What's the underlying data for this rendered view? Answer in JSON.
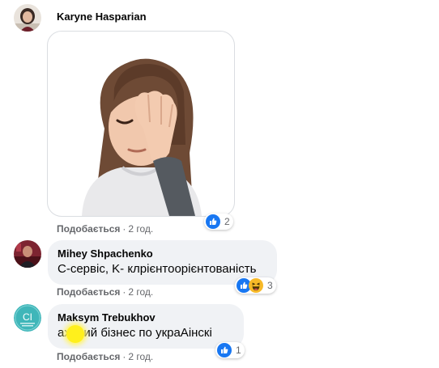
{
  "colors": {
    "bubble_bg": "#f0f2f5",
    "meta_text": "#65676b",
    "like_blue": "#1877f2",
    "haha_yellow": "#f7b928",
    "censor_yellow": "#fff01c"
  },
  "comments": [
    {
      "author": "Karyne Hasparian",
      "avatar_icon": "profile-photo",
      "attachment": "facepalm-avatar-sticker",
      "like_label": "Подобається",
      "time": "2 год.",
      "reaction_icons": [
        "like-icon"
      ],
      "reaction_count": "2"
    },
    {
      "author": "Mihey Shpachenko",
      "avatar_icon": "profile-photo",
      "text": "C-сервіс, K- клрієнтоорієнтованість",
      "like_label": "Подобається",
      "time": "2 год.",
      "reaction_icons": [
        "like-icon",
        "haha-icon"
      ],
      "reaction_count": "3"
    },
    {
      "author": "Maksym Trebukhov",
      "avatar_icon": "profile-logo-ci",
      "avatar_text": "CI",
      "text_prefix": "ах",
      "text_rest": "нний бізнес по украАінскі",
      "like_label": "Подобається",
      "time": "2 год.",
      "reaction_icons": [
        "like-icon"
      ],
      "reaction_count": "1"
    }
  ]
}
